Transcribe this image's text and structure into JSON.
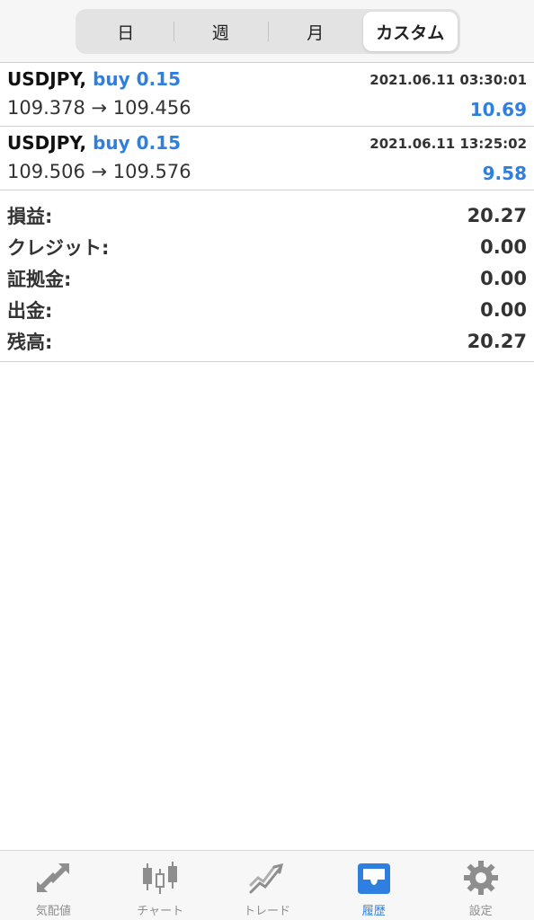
{
  "period_tabs": [
    {
      "label": "日",
      "active": false
    },
    {
      "label": "週",
      "active": false
    },
    {
      "label": "月",
      "active": false
    },
    {
      "label": "カスタム",
      "active": true
    }
  ],
  "trades": [
    {
      "symbol": "USDJPY,",
      "side": "buy 0.15",
      "time": "2021.06.11 03:30:01",
      "prices": "109.378 → 109.456",
      "profit": "10.69"
    },
    {
      "symbol": "USDJPY,",
      "side": "buy 0.15",
      "time": "2021.06.11 13:25:02",
      "prices": "109.506 → 109.576",
      "profit": "9.58"
    }
  ],
  "summary": [
    {
      "label": "損益:",
      "value": "20.27"
    },
    {
      "label": "クレジット:",
      "value": "0.00"
    },
    {
      "label": "証拠金:",
      "value": "0.00"
    },
    {
      "label": "出金:",
      "value": "0.00"
    },
    {
      "label": "残高:",
      "value": "20.27"
    }
  ],
  "tabbar": [
    {
      "label": "気配値",
      "icon": "quotes-arrows-icon",
      "active": false
    },
    {
      "label": "チャート",
      "icon": "candlestick-chart-icon",
      "active": false
    },
    {
      "label": "トレード",
      "icon": "trade-chart-icon",
      "active": false
    },
    {
      "label": "履歴",
      "icon": "history-inbox-icon",
      "active": true
    },
    {
      "label": "設定",
      "icon": "settings-gear-icon",
      "active": false
    }
  ],
  "colors": {
    "accent": "#2f7fe0",
    "icon_inactive": "#8e8e8e"
  }
}
